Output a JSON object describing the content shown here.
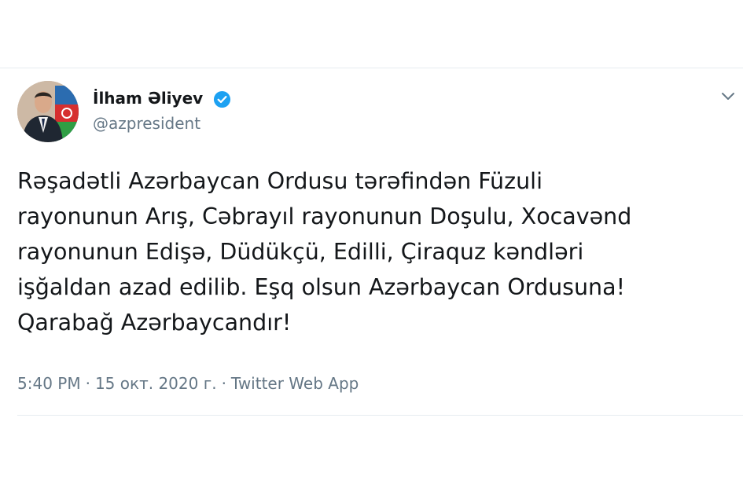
{
  "author": {
    "name": "İlham Əliyev",
    "handle": "@azpresident",
    "verified": true
  },
  "tweet": {
    "lines": [
      "Rəşadətli Azərbaycan Ordusu tərəfindən Füzuli",
      "rayonunun Arış, Cəbrayıl rayonunun Doşulu, Xocavənd",
      "rayonunun Edişə, Düdükçü, Edilli, Çiraquz kəndləri",
      "işğaldan azad edilib. Eşq olsun Azərbaycan Ordusuna!",
      "Qarabağ Azərbaycandır!"
    ]
  },
  "meta": {
    "time": "5:40 PM",
    "separator": "·",
    "date": "15 окт. 2020 г.",
    "source": "Twitter Web App"
  },
  "icons": {
    "verified": "verified-badge-icon",
    "menu": "chevron-down-icon"
  },
  "colors": {
    "accent": "#1da1f2",
    "secondary_text": "#657786",
    "primary_text": "#14171a"
  }
}
